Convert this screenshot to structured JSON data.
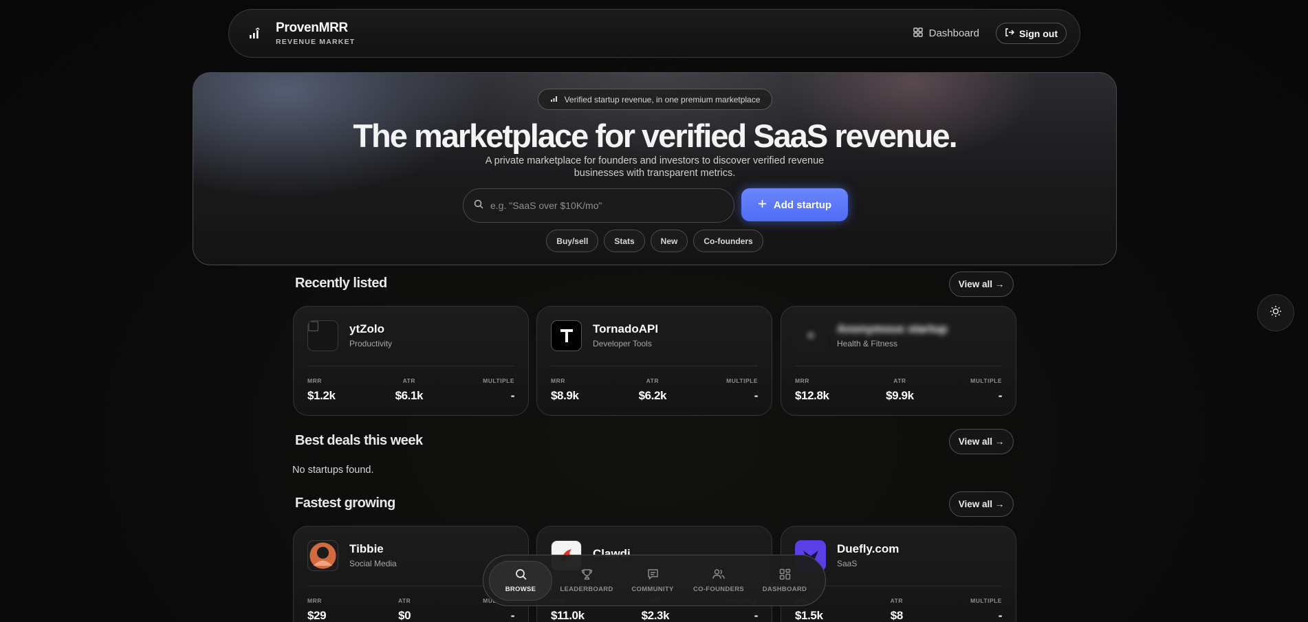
{
  "brand": {
    "name": "ProvenMRR",
    "subtitle": "REVENUE MARKET",
    "icon": "bar-chart-icon"
  },
  "nav": {
    "dashboard_label": "Dashboard",
    "signout_label": "Sign out"
  },
  "hero": {
    "pill_text": "Verified startup revenue, in one premium marketplace",
    "title": "The marketplace for verified SaaS revenue.",
    "subtitle_line1": "A private marketplace for founders and investors to discover verified revenue",
    "subtitle_line2": "businesses with transparent metrics.",
    "search_placeholder": "e.g. \"SaaS over $10K/mo\"",
    "add_button": "Add startup",
    "chips": [
      "Buy/sell",
      "Stats",
      "New",
      "Co-founders"
    ]
  },
  "sections": {
    "recent": {
      "title": "Recently listed",
      "view_all": "View all →",
      "cards": [
        {
          "name": "ytZolo",
          "category": "Productivity",
          "mrr": "$1.2k",
          "atr": "$6.1k",
          "multiple": "-"
        },
        {
          "name": "TornadoAPI",
          "category": "Developer Tools",
          "mrr": "$8.9k",
          "atr": "$6.2k",
          "multiple": "-"
        },
        {
          "name": "Anonymous startup",
          "category": "Health & Fitness",
          "mrr": "$12.8k",
          "atr": "$9.9k",
          "multiple": "-"
        }
      ]
    },
    "deals": {
      "title": "Best deals this week",
      "view_all": "View all →",
      "empty": "No startups found."
    },
    "growing": {
      "title": "Fastest growing",
      "view_all": "View all →",
      "cards": [
        {
          "name": "Tibbie",
          "category": "Social Media",
          "mrr": "$29",
          "atr": "$0",
          "multiple": "-"
        },
        {
          "name": "Clawdi",
          "category": "",
          "mrr": "$11.0k",
          "atr": "$2.3k",
          "multiple": "-"
        },
        {
          "name": "Duefly.com",
          "category": "SaaS",
          "mrr": "$1.5k",
          "atr": "$8",
          "multiple": "-"
        }
      ]
    }
  },
  "metric_labels": {
    "mrr": "MRR",
    "atr": "ATR",
    "multiple": "MULTIPLE"
  },
  "dock": [
    {
      "label": "BROWSE",
      "icon": "search-icon",
      "active": true
    },
    {
      "label": "LEADERBOARD",
      "icon": "trophy-icon",
      "active": false
    },
    {
      "label": "COMMUNITY",
      "icon": "message-icon",
      "active": false
    },
    {
      "label": "CO-FOUNDERS",
      "icon": "users-icon",
      "active": false
    },
    {
      "label": "DASHBOARD",
      "icon": "grid-icon",
      "active": false
    }
  ],
  "colors": {
    "accent": "#5b78fb",
    "background": "#0b0b0b"
  }
}
